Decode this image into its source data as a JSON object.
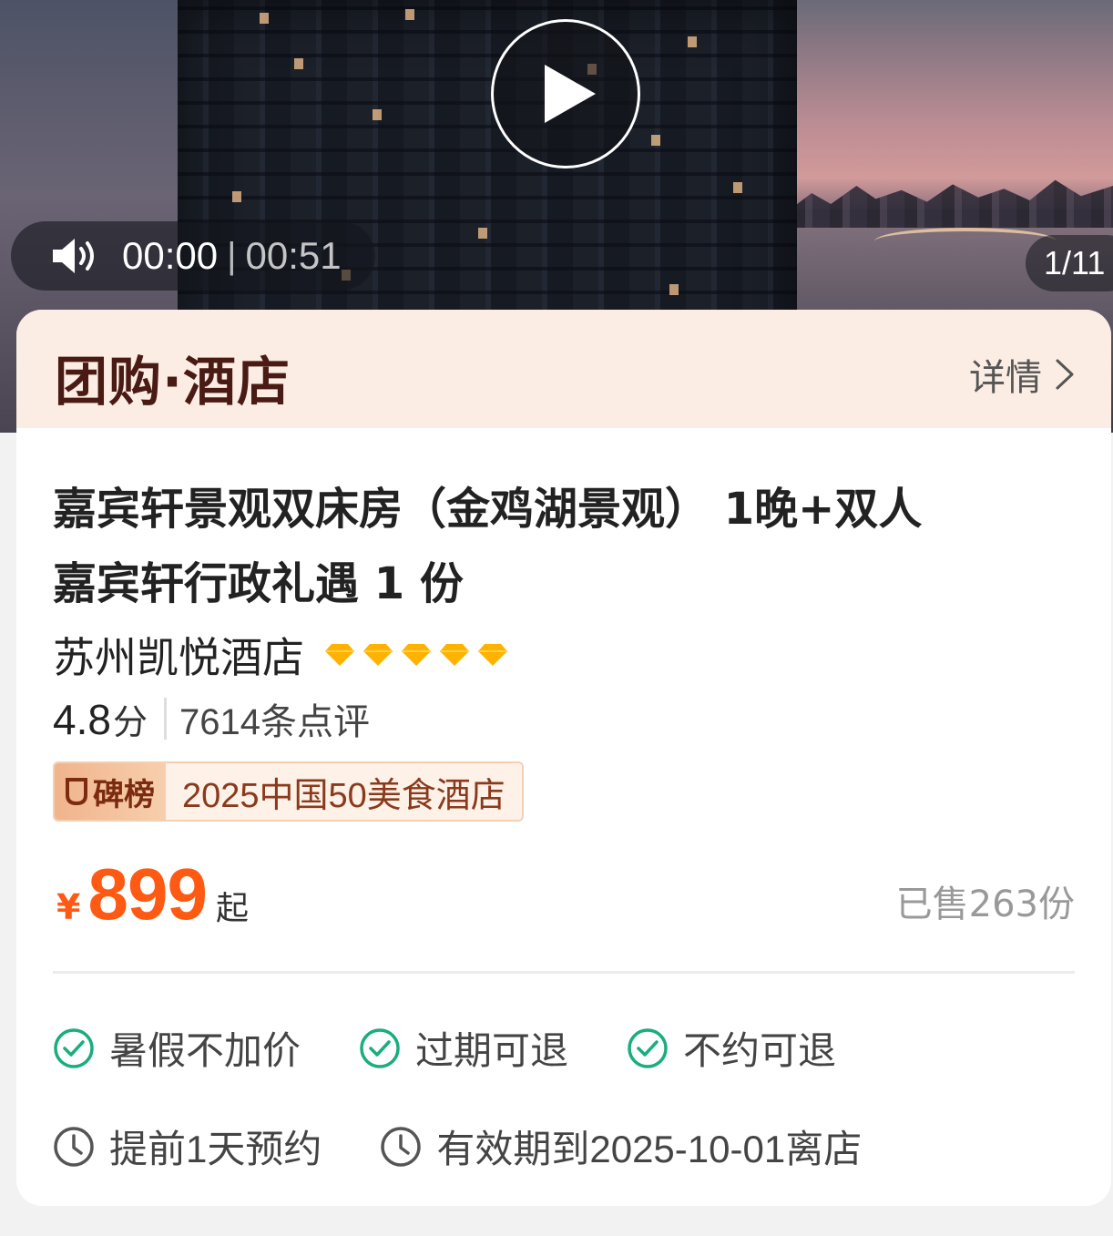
{
  "media": {
    "current_time": "00:00",
    "separator": "|",
    "duration": "00:51",
    "counter": "1/11"
  },
  "header": {
    "brand": "团购·酒店",
    "details_label": "详情"
  },
  "product": {
    "title_line1": "嘉宾轩景观双床房（金鸡湖景观） 1晚+双人",
    "title_line2": "嘉宾轩行政礼遇 1 份",
    "hotel_name": "苏州凯悦酒店",
    "diamond_count": 5,
    "score": "4.8",
    "score_unit": "分",
    "reviews": "7614条点评",
    "rank_label": "碑榜",
    "rank_text": "2025中国50美食酒店",
    "currency": "¥",
    "price": "899",
    "price_suffix": "起",
    "sold": "已售263份"
  },
  "features": [
    {
      "label": "暑假不加价"
    },
    {
      "label": "过期可退"
    },
    {
      "label": "不约可退"
    }
  ],
  "info": [
    {
      "label": "提前1天预约"
    },
    {
      "label": "有效期到2025-10-01离店"
    }
  ],
  "colors": {
    "accent": "#ff5a14",
    "header_bg": "#fbede4",
    "brand_text": "#4a1a14",
    "diamond": "#ffb300",
    "check": "#1aad7e"
  }
}
